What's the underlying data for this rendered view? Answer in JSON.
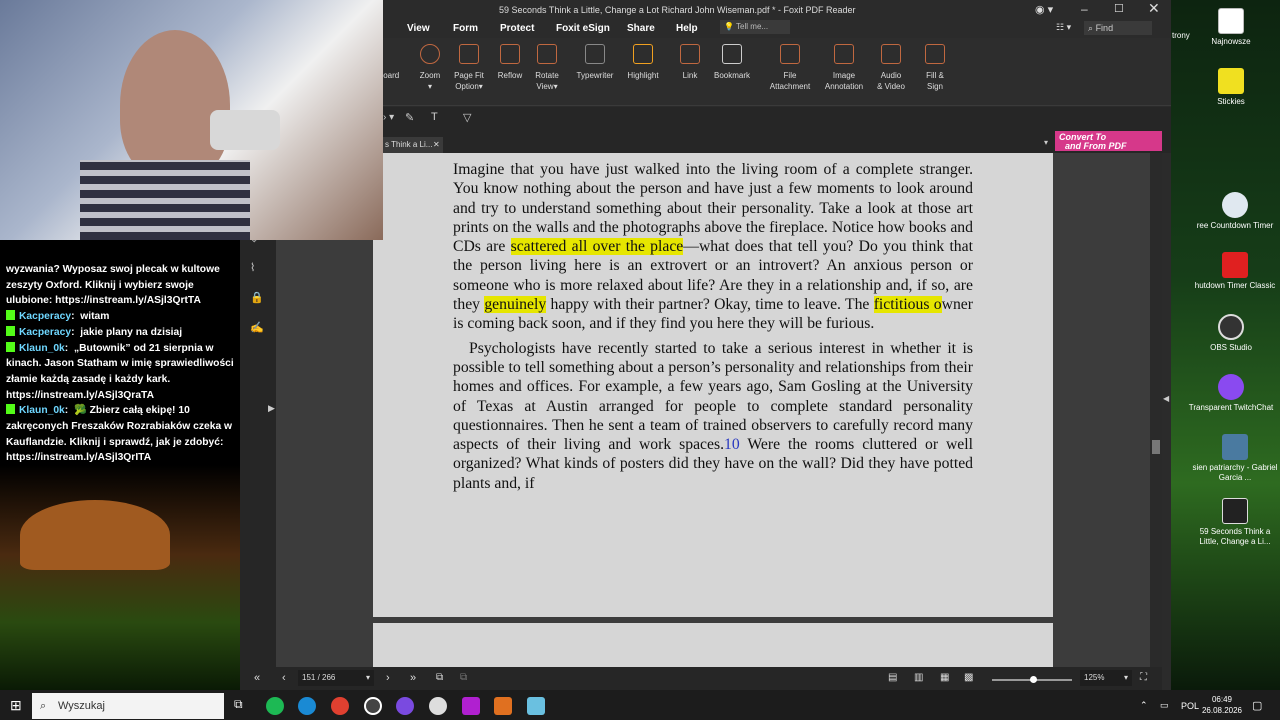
{
  "window": {
    "title": "59 Seconds Think a Little, Change a Lot Richard John Wiseman.pdf * - Foxit PDF Reader"
  },
  "menu": [
    "View",
    "Form",
    "Protect",
    "Foxit eSign",
    "Share",
    "Help"
  ],
  "tell_me_placeholder": "Tell me...",
  "find_placeholder": "Find",
  "ribbon": {
    "board": "board",
    "zoom": "Zoom",
    "page_fit_1": "Page Fit",
    "page_fit_2": "Option",
    "reflow": "Reflow",
    "rotate_1": "Rotate",
    "rotate_2": "View",
    "typewriter": "Typewriter",
    "highlight": "Highlight",
    "link": "Link",
    "bookmark": "Bookmark",
    "file_attach_1": "File",
    "file_attach_2": "Attachment",
    "image_annot_1": "Image",
    "image_annot_2": "Annotation",
    "audio_video_1": "Audio",
    "audio_video_2": "& Video",
    "fill_sign_1": "Fill &",
    "fill_sign_2": "Sign"
  },
  "doc_tab": "s Think a Li...",
  "convert": {
    "line1": "Convert To",
    "line2": "and From PDF"
  },
  "page_text": {
    "p1_a": "Imagine that you have just walked into the living room of a complete stranger. You know nothing about the person and have just a few moments to look around and try to understand something about their personality. Take a look at those art prints on the walls and the photographs above the fireplace. Notice how books and CDs are ",
    "p1_hl1": "scattered all over the place",
    "p1_b": "—what does that tell you? Do you think that the person living here is an extrovert or an introvert? An anxious person or someone who is more relaxed about life? Are they in a relationship and, if so, are they ",
    "p1_hl2": "genuinely",
    "p1_c": " happy with their partner? Okay, time to leave. The ",
    "p1_hl3": "fictitious o",
    "p1_d": "wner is coming back soon, and if they find you here they will be furious.",
    "p2_a": "Psychologists have recently started to take a serious interest in whether it is possible to tell something about a person’s personality and relationships from their homes and offices. For example, a few years ago, Sam Gosling at the University of Texas at Austin arranged for people to complete standard personality questionnaires. Then he sent a team of trained observers to carefully record many aspects of their living and work spaces.",
    "p2_fn": "10",
    "p2_b": " Were the rooms cluttered or well organized? What kinds of posters did they have on the wall? Did they have potted plants and, if"
  },
  "status": {
    "page": "151 / 266",
    "zoom": "125%"
  },
  "desktop_icons": [
    "Najnowsze",
    "Stickies",
    "ree Countdown Timer",
    "hutdown Timer Classic",
    "OBS Studio",
    "Transparent TwitchChat",
    "sien patriarchy - Gabriel Garcia ...",
    "59 Seconds Think a Little, Change a Li..."
  ],
  "desktop_partial": "trony",
  "chat": {
    "intro": "wyzwania? Wyposaz swoj plecak w kultowe zeszyty Oxford. Kliknij i wybierz swoje ulubione: https://instream.ly/ASjl3QrtTA",
    "messages": [
      {
        "user": "Kacperacy",
        "text": "witam"
      },
      {
        "user": "Kacperacy",
        "text": "jakie plany na dzisiaj"
      },
      {
        "user": "Klaun_0k",
        "text": "„Butownik” od 21 sierpnia w kinach. Jason Statham w imię sprawiedliwości złamie każdą zasadę i każdy kark. https://instream.ly/ASjl3QraTA"
      },
      {
        "user": "Klaun_0k",
        "text": "🥦 Zbierz całą ekipę! 10 zakręconych Freszaków Rozrabiaków czeka w Kauflandzie. Kliknij i sprawdź, jak je zdobyć: https://instream.ly/ASjl3QrITA"
      }
    ]
  },
  "taskbar": {
    "search": "Wyszukaj",
    "lang": "POL",
    "time": "06:49",
    "date": "26.08.2026"
  }
}
